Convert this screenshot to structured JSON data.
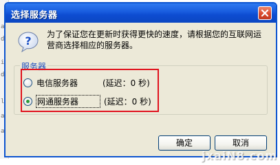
{
  "background": {
    "marks": [
      "al",
      "di",
      "iz",
      "di",
      "ld",
      "al",
      "al"
    ]
  },
  "dialog": {
    "title": "选择服务器",
    "message": "为了保证您在更新时获得更快的速度，请根据您的互联网运营商选择相应的服务器。",
    "group_title": "服务器",
    "options": [
      {
        "label": "电信服务器",
        "delay": "(延迟：0 秒)",
        "checked": false
      },
      {
        "label": "网通服务器",
        "delay": "(延迟：0 秒)",
        "checked": true
      }
    ],
    "ok_label": "确定",
    "cancel_label": "取消"
  },
  "watermark": "jxaiN8.com",
  "colors": {
    "titlebar": "#0c47c2",
    "dialog_bg": "#ece9d8",
    "group_title": "#1f4fbf",
    "highlight_border": "#e0111c",
    "close_button": "#d9482b"
  },
  "icons": {
    "titlebar_close": "close-icon",
    "message": "question-icon"
  }
}
